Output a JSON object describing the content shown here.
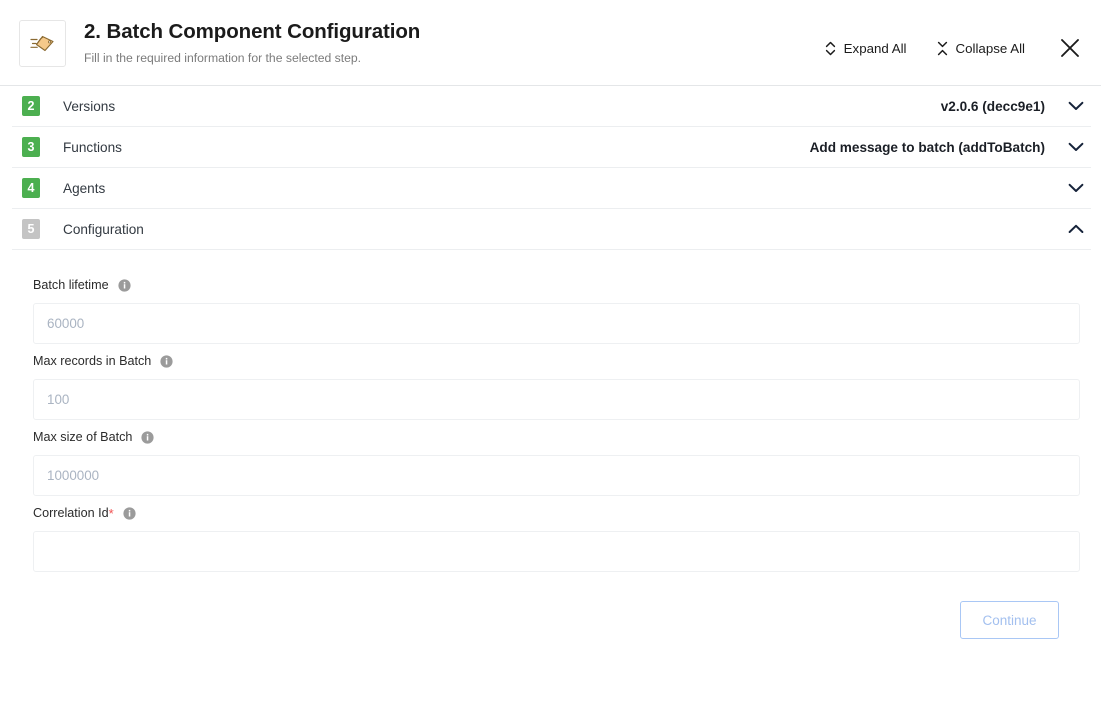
{
  "header": {
    "icon": "tag-icon",
    "title": "2. Batch Component Configuration",
    "subtitle": "Fill in the required information for the selected step.",
    "expand_all_label": "Expand All",
    "collapse_all_label": "Collapse All",
    "expand_icon": "expand-chevrons-icon",
    "collapse_icon": "collapse-chevrons-icon",
    "close_icon": "close-icon"
  },
  "accordion": {
    "items": [
      {
        "number": "2",
        "label": "Versions",
        "value": "v2.0.6 (decc9e1)",
        "state": "collapsed",
        "badge_color": "#4caf50",
        "chevron": "chevron-down-icon"
      },
      {
        "number": "3",
        "label": "Functions",
        "value": "Add message to batch (addToBatch)",
        "state": "collapsed",
        "badge_color": "#4caf50",
        "chevron": "chevron-down-icon"
      },
      {
        "number": "4",
        "label": "Agents",
        "value": "",
        "state": "collapsed",
        "badge_color": "#4caf50",
        "chevron": "chevron-down-icon"
      },
      {
        "number": "5",
        "label": "Configuration",
        "value": "",
        "state": "expanded",
        "badge_color": "#c4c4c4",
        "chevron": "chevron-up-icon"
      }
    ]
  },
  "form": {
    "fields": [
      {
        "label": "Batch lifetime",
        "required": false,
        "value": "",
        "placeholder": "60000",
        "info_icon": "info-icon"
      },
      {
        "label": "Max records in Batch",
        "required": false,
        "value": "",
        "placeholder": "100",
        "info_icon": "info-icon"
      },
      {
        "label": "Max size of Batch",
        "required": false,
        "value": "",
        "placeholder": "1000000",
        "info_icon": "info-icon"
      },
      {
        "label": "Correlation Id",
        "required": true,
        "required_marker": "*",
        "value": "",
        "placeholder": "",
        "info_icon": "info-icon"
      }
    ]
  },
  "footer": {
    "continue_label": "Continue",
    "continue_enabled": false,
    "accent_color": "#a9c7f5"
  }
}
